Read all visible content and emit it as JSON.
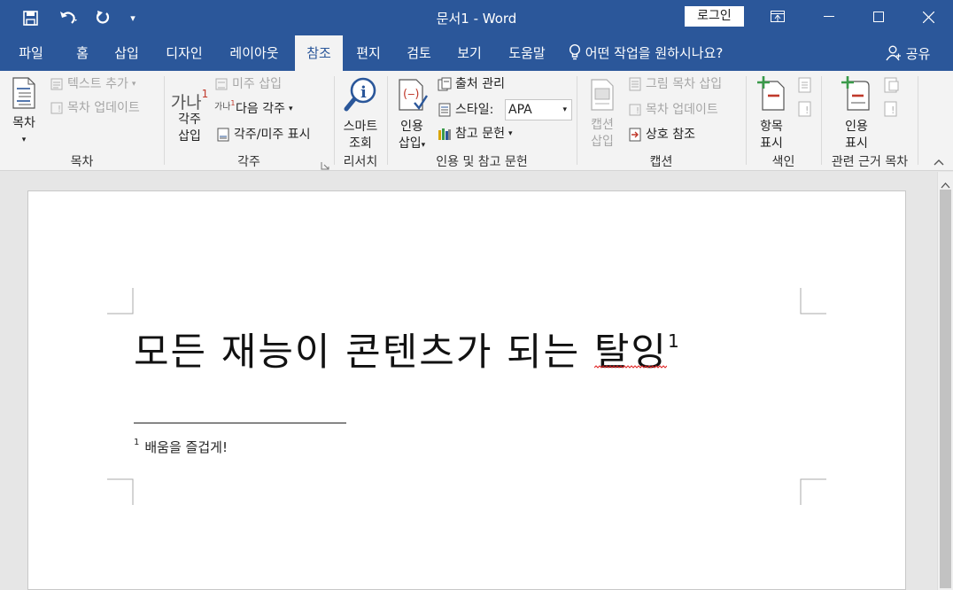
{
  "window": {
    "title": "문서1  -  Word",
    "login_label": "로그인"
  },
  "tabs": [
    "파일",
    "홈",
    "삽입",
    "디자인",
    "레이아웃",
    "참조",
    "편지",
    "검토",
    "보기",
    "도움말"
  ],
  "active_tab": "참조",
  "tellme": "어떤 작업을 원하시나요?",
  "share_label": "공유",
  "ribbon": {
    "toc": {
      "big_label_1": "목차",
      "add_text": "텍스트 추가",
      "update_toc": "목차 업데이트",
      "group_label": "목차"
    },
    "footnotes": {
      "icon_text": "가나",
      "icon_sup": "1",
      "big_label_1": "각주",
      "big_label_2": "삽입",
      "insert_endnote": "미주 삽입",
      "next_footnote_icon": "가나",
      "next_footnote": "다음 각주",
      "show_notes": "각주/미주 표시",
      "group_label": "각주"
    },
    "research": {
      "big_label_1": "스마트",
      "big_label_2": "조회",
      "group_label": "리서치"
    },
    "citations": {
      "big_label_1": "인용",
      "big_label_2": "삽입",
      "manage_sources": "출처 관리",
      "style_label": "스타일:",
      "style_value": "APA",
      "bibliography": "참고 문헌",
      "group_label": "인용 및 참고 문헌"
    },
    "captions": {
      "big_label_1": "캡션",
      "big_label_2": "삽입",
      "insert_tof": "그림 목차 삽입",
      "update_table": "목차 업데이트",
      "cross_ref": "상호 참조",
      "group_label": "캡션"
    },
    "index": {
      "big_label_1": "항목",
      "big_label_2": "표시",
      "group_label": "색인"
    },
    "toa": {
      "big_label_1": "인용",
      "big_label_2": "표시",
      "group_label": "관련 근거 목차"
    }
  },
  "document": {
    "heading": "모든 재능이 콘텐츠가 되는 탈잉",
    "heading_ref": "1",
    "footnote_num": "1",
    "footnote_text": "배움을 즐겁게!"
  },
  "colors": {
    "accent": "#2b579a",
    "ribbon_bg": "#f3f3f3",
    "disabled": "#a6a6a6",
    "red": "#c0392b",
    "green": "#3a9a4a"
  }
}
